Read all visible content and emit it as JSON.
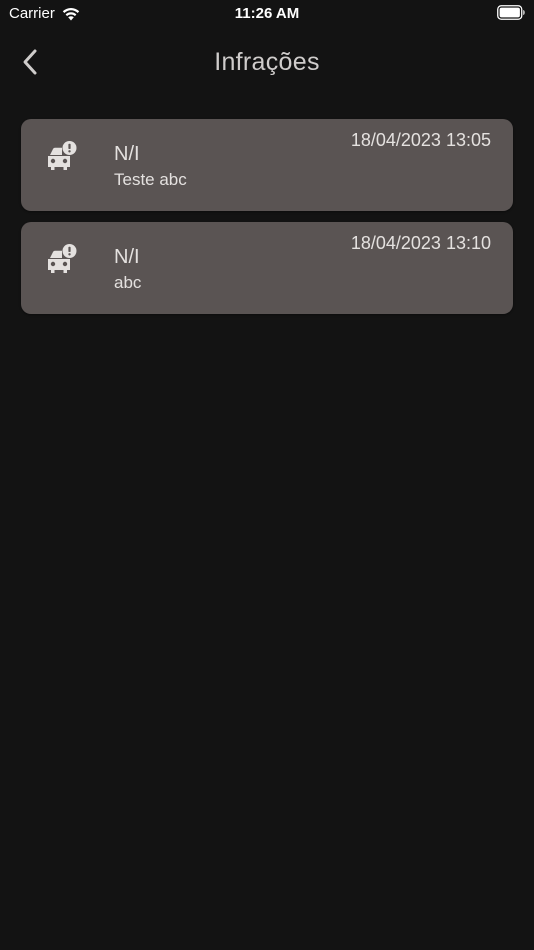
{
  "status_bar": {
    "carrier": "Carrier",
    "time": "11:26 AM"
  },
  "nav": {
    "title": "Infrações"
  },
  "infractions": [
    {
      "title": "N/I",
      "description": "Teste abc",
      "datetime": "18/04/2023 13:05",
      "icon": "car-alert-icon"
    },
    {
      "title": "N/I",
      "description": "abc",
      "datetime": "18/04/2023 13:10",
      "icon": "car-alert-icon"
    }
  ],
  "colors": {
    "background": "#131313",
    "card": "#5a5453",
    "text": "#e4e1df"
  }
}
